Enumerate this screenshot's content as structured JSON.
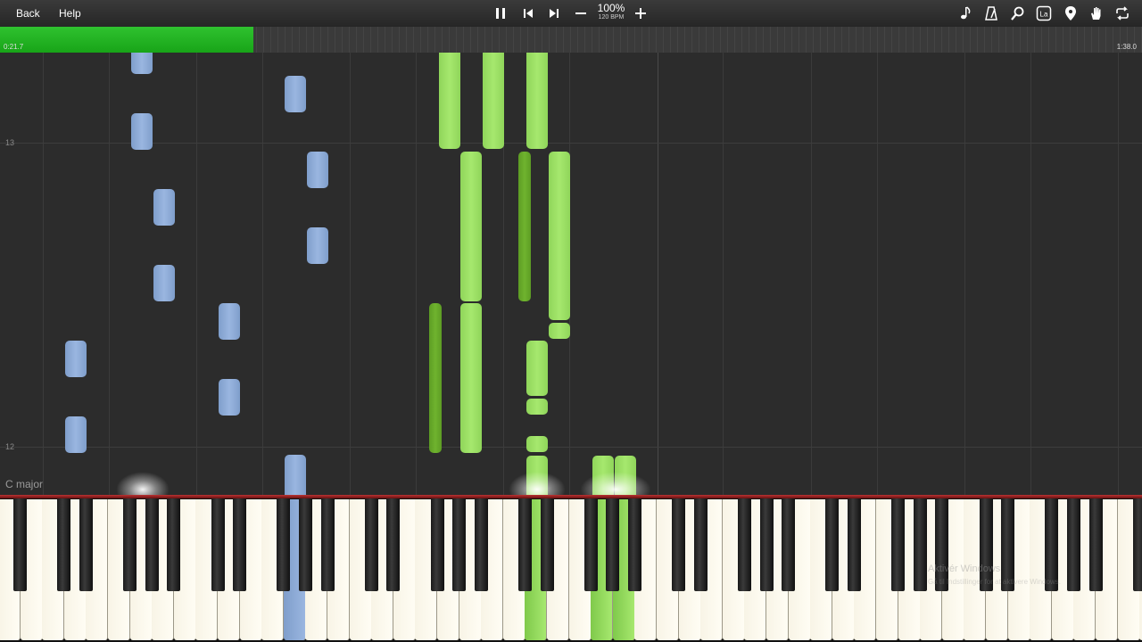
{
  "toolbar": {
    "back_label": "Back",
    "help_label": "Help",
    "speed_percent": "100%",
    "speed_bpm": "120 BPM",
    "icons": [
      "pause-icon",
      "previous-icon",
      "next-icon",
      "minus-icon",
      "plus-icon",
      "note-icon",
      "metronome-icon",
      "magnifier-icon",
      "label-icon",
      "location-pin-icon",
      "hand-icon",
      "loop-icon"
    ],
    "label_icon_text": "La"
  },
  "progress": {
    "current_time": "0:21.7",
    "total_time": "1:38.0",
    "fraction": 0.222,
    "color": "#22b022"
  },
  "roll": {
    "measure_labels": [
      "13",
      "12"
    ],
    "key_signature": "C major",
    "colors": {
      "left_hand": "#94b1dc",
      "right_hand": "#9fe069",
      "right_hand_dark": "#65a82a"
    }
  },
  "watermark": {
    "line1": "Aktivér Windows",
    "line2": "Gå til Indstillinger for at aktivere Windows."
  }
}
